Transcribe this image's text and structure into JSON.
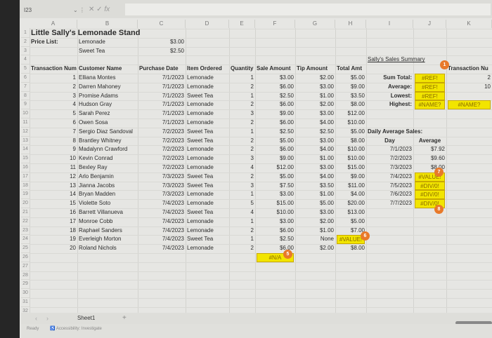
{
  "formula_bar": {
    "name_box": "I23",
    "icons": [
      "x-icon",
      "check-icon",
      "fx-icon"
    ],
    "fx_label": "fx",
    "formula": ""
  },
  "columns": [
    "A",
    "B",
    "C",
    "D",
    "E",
    "F",
    "G",
    "H",
    "I",
    "J",
    "K"
  ],
  "title": "Little Sally's Lemonade Stand",
  "price_list": {
    "label": "Price List:",
    "items": [
      {
        "name": "Lemonade",
        "price": "$3.00"
      },
      {
        "name": "Sweet Tea",
        "price": "$2.50"
      }
    ]
  },
  "table_headers": [
    "Transaction Num",
    "Customer Name",
    "Purchase Date",
    "Item Ordered",
    "Quantity",
    "Sale Amount",
    "Tip Amount",
    "Total Amt"
  ],
  "transactions": [
    [
      "1",
      "Elliana Montes",
      "7/1/2023",
      "Lemonade",
      "1",
      "$3.00",
      "$2.00",
      "$5.00"
    ],
    [
      "2",
      "Darren Mahoney",
      "7/1/2023",
      "Lemonade",
      "2",
      "$6.00",
      "$3.00",
      "$9.00"
    ],
    [
      "3",
      "Promise Adams",
      "7/1/2023",
      "Sweet Tea",
      "1",
      "$2.50",
      "$1.00",
      "$3.50"
    ],
    [
      "4",
      "Hudson Gray",
      "7/1/2023",
      "Lemonade",
      "2",
      "$6.00",
      "$2.00",
      "$8.00"
    ],
    [
      "5",
      "Sarah Perez",
      "7/1/2023",
      "Lemonade",
      "3",
      "$9.00",
      "$3.00",
      "$12.00"
    ],
    [
      "6",
      "Owen Sosa",
      "7/1/2023",
      "Lemonade",
      "2",
      "$6.00",
      "$4.00",
      "$10.00"
    ],
    [
      "7",
      "Sergio Diaz Sandoval",
      "7/2/2023",
      "Sweet Tea",
      "1",
      "$2.50",
      "$2.50",
      "$5.00"
    ],
    [
      "8",
      "Brantley Whitney",
      "7/2/2023",
      "Sweet Tea",
      "2",
      "$5.00",
      "$3.00",
      "$8.00"
    ],
    [
      "9",
      "Madalynn Crawford",
      "7/2/2023",
      "Lemonade",
      "2",
      "$6.00",
      "$4.00",
      "$10.00"
    ],
    [
      "10",
      "Kevin Conrad",
      "7/2/2023",
      "Lemonade",
      "3",
      "$9.00",
      "$1.00",
      "$10.00"
    ],
    [
      "11",
      "Bexley Ray",
      "7/2/2023",
      "Lemonade",
      "4",
      "$12.00",
      "$3.00",
      "$15.00"
    ],
    [
      "12",
      "Arlo Benjamin",
      "7/3/2023",
      "Sweet Tea",
      "2",
      "$5.00",
      "$4.00",
      "$9.00"
    ],
    [
      "13",
      "Jianna Jacobs",
      "7/3/2023",
      "Sweet Tea",
      "3",
      "$7.50",
      "$3.50",
      "$11.00"
    ],
    [
      "14",
      "Bryan Madden",
      "7/3/2023",
      "Lemonade",
      "1",
      "$3.00",
      "$1.00",
      "$4.00"
    ],
    [
      "15",
      "Violette Soto",
      "7/4/2023",
      "Lemonade",
      "5",
      "$15.00",
      "$5.00",
      "$20.00"
    ],
    [
      "16",
      "Barrett Villanueva",
      "7/4/2023",
      "Sweet Tea",
      "4",
      "$10.00",
      "$3.00",
      "$13.00"
    ],
    [
      "17",
      "Monroe Cobb",
      "7/4/2023",
      "Lemonade",
      "1",
      "$3.00",
      "$2.00",
      "$5.00"
    ],
    [
      "18",
      "Raphael Sanders",
      "7/4/2023",
      "Lemonade",
      "2",
      "$6.00",
      "$1.00",
      "$7.00"
    ],
    [
      "19",
      "Everleigh Morton",
      "7/4/2023",
      "Sweet Tea",
      "1",
      "$2.50",
      "None",
      "#VALUE!"
    ],
    [
      "20",
      "Roland Nichols",
      "7/4/2023",
      "Lemonade",
      "2",
      "$6.00",
      "$2.00",
      "$8.00"
    ]
  ],
  "sale_amount_extra": "#N/A",
  "summary": {
    "title": "Sally's Sales Summary",
    "transaction_header": "Transaction Nu",
    "rows": [
      {
        "label": "Sum Total:",
        "value": "#REF!",
        "txn": "2"
      },
      {
        "label": "Average:",
        "value": "#REF!",
        "txn": "10"
      },
      {
        "label": "Lowest:",
        "value": "#REF!",
        "txn": ""
      },
      {
        "label": "Highest:",
        "value": "#NAME?",
        "txn": "#NAME?"
      }
    ]
  },
  "daily": {
    "title": "Daily Average Sales:",
    "headers": [
      "Day",
      "Average"
    ],
    "rows": [
      [
        "7/1/2023",
        "$7.92"
      ],
      [
        "7/2/2023",
        "$9.60"
      ],
      [
        "7/3/2023",
        "$8.00"
      ],
      [
        "7/4/2023",
        "#VALUE!"
      ],
      [
        "7/5/2023",
        "#DIV/0!"
      ],
      [
        "7/6/2023",
        "#DIV/0!"
      ],
      [
        "7/7/2023",
        "#DIV/0!"
      ]
    ]
  },
  "markers": [
    "1",
    "5",
    "6",
    "7",
    "8"
  ],
  "colors": {
    "error_fill": "#f2e500",
    "marker": "#e8792a"
  },
  "sheet_tabs": {
    "active": "Sheet1",
    "add": "+"
  },
  "status": {
    "ready": "Ready",
    "accessibility": "Accessibility: Investigate"
  }
}
